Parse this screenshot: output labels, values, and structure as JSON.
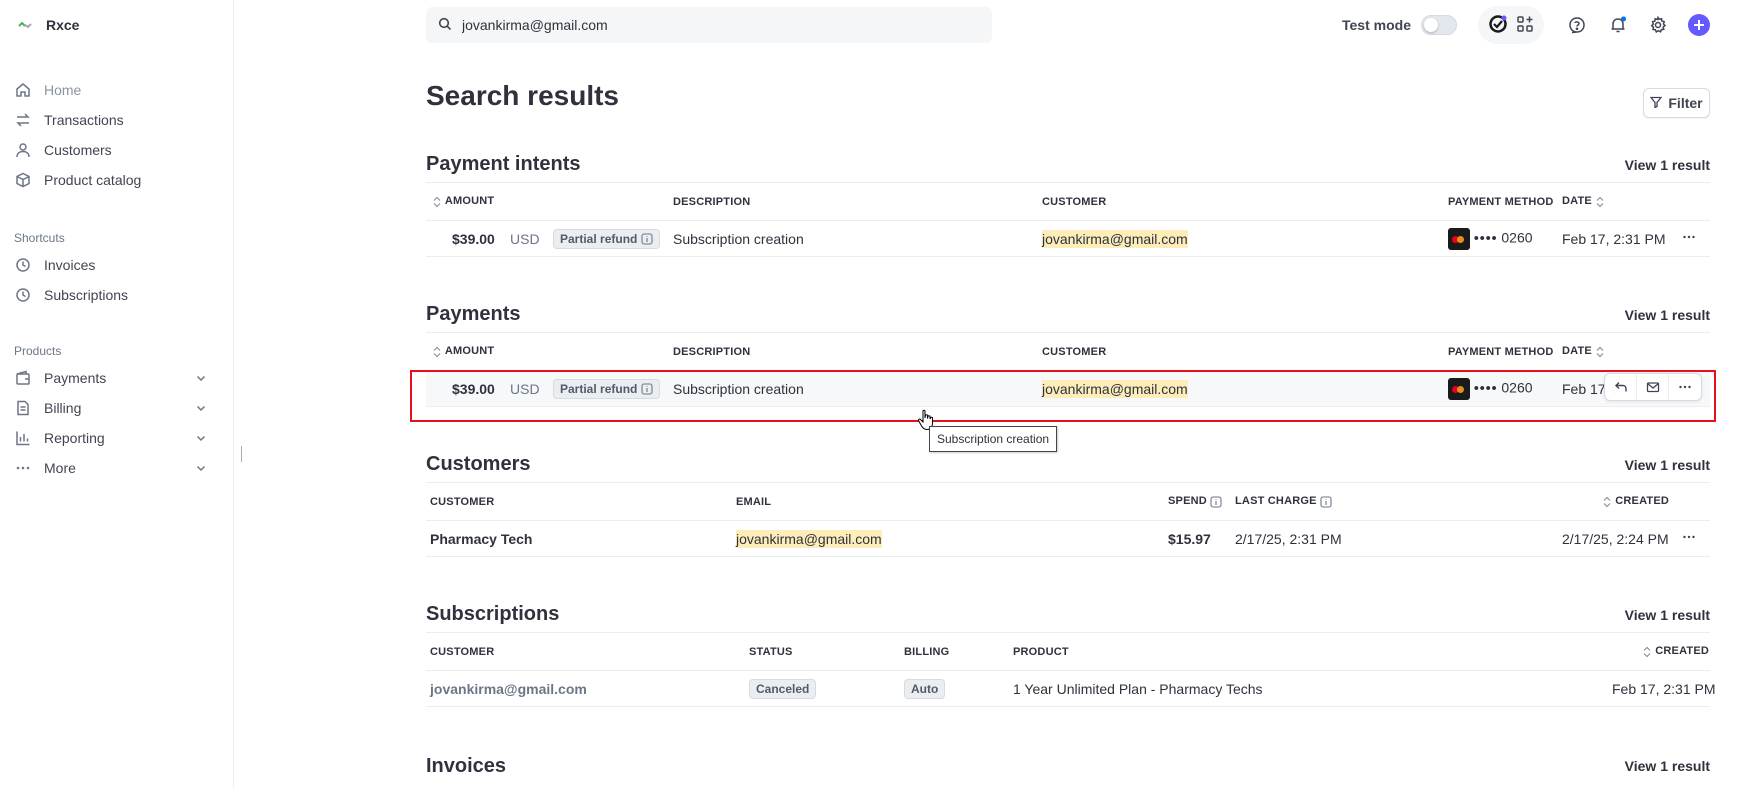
{
  "brand": {
    "name": "Rxce"
  },
  "nav": {
    "home": "Home",
    "transactions": "Transactions",
    "customers": "Customers",
    "product_catalog": "Product catalog",
    "shortcuts_label": "Shortcuts",
    "invoices": "Invoices",
    "subscriptions": "Subscriptions",
    "products_label": "Products",
    "payments": "Payments",
    "billing": "Billing",
    "reporting": "Reporting",
    "more": "More"
  },
  "topbar": {
    "search_value": "jovankirma@gmail.com",
    "test_mode_label": "Test mode"
  },
  "page": {
    "title": "Search results",
    "filter_label": "Filter"
  },
  "payment_intents": {
    "title": "Payment intents",
    "view_link": "View 1 result",
    "columns": {
      "amount": "AMOUNT",
      "description": "DESCRIPTION",
      "customer": "CUSTOMER",
      "payment_method": "PAYMENT METHOD",
      "date": "DATE"
    },
    "row": {
      "amount": "$39.00",
      "currency": "USD",
      "status": "Partial refund",
      "description": "Subscription creation",
      "customer": "jovankirma@gmail.com",
      "card_dots": "••••",
      "card_last4": "0260",
      "date": "Feb 17, 2:31 PM"
    }
  },
  "payments": {
    "title": "Payments",
    "view_link": "View 1 result",
    "columns": {
      "amount": "AMOUNT",
      "description": "DESCRIPTION",
      "customer": "CUSTOMER",
      "payment_method": "PAYMENT METHOD",
      "date": "DATE"
    },
    "row": {
      "amount": "$39.00",
      "currency": "USD",
      "status": "Partial refund",
      "description": "Subscription creation",
      "customer": "jovankirma@gmail.com",
      "card_dots": "••••",
      "card_last4": "0260",
      "date": "Feb 17,"
    },
    "tooltip": "Subscription creation"
  },
  "customers": {
    "title": "Customers",
    "view_link": "View 1 result",
    "columns": {
      "customer": "CUSTOMER",
      "email": "EMAIL",
      "spend": "SPEND",
      "last_charge": "LAST CHARGE",
      "created": "CREATED"
    },
    "row": {
      "customer": "Pharmacy Tech",
      "email": "jovankirma@gmail.com",
      "spend": "$15.97",
      "last_charge": "2/17/25, 2:31 PM",
      "created": "2/17/25, 2:24 PM"
    }
  },
  "subscriptions": {
    "title": "Subscriptions",
    "view_link": "View 1 result",
    "columns": {
      "customer": "CUSTOMER",
      "status": "STATUS",
      "billing": "BILLING",
      "product": "PRODUCT",
      "created": "CREATED"
    },
    "row": {
      "customer": "jovankirma@gmail.com",
      "status": "Canceled",
      "billing": "Auto",
      "product": "1 Year Unlimited Plan - Pharmacy Techs",
      "created": "Feb 17, 2:31 PM"
    }
  },
  "invoices": {
    "title": "Invoices",
    "view_link": "View 1 result"
  },
  "colors": {
    "accent": "#635bff",
    "highlight": "#fcedb9",
    "selection_border": "#e8111b"
  }
}
